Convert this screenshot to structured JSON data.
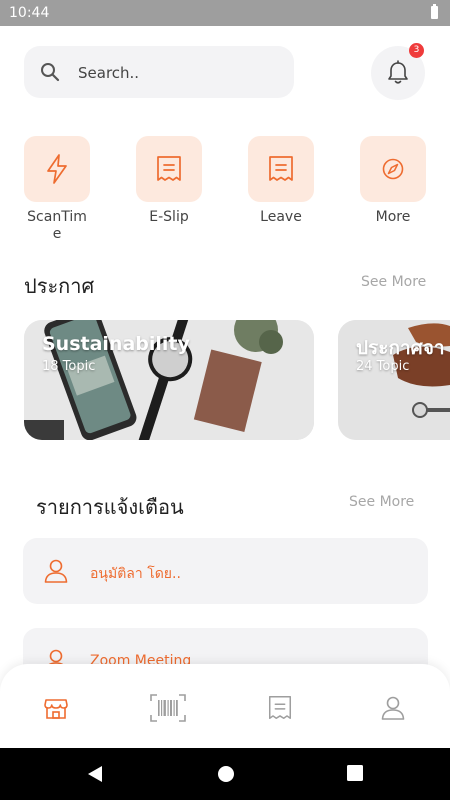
{
  "status_bar": {
    "time": "10:44"
  },
  "search": {
    "placeholder": "Search.."
  },
  "notifications_badge": "3",
  "menu": [
    {
      "label": "ScanTime",
      "icon": "lightning-icon"
    },
    {
      "label": "E-Slip",
      "icon": "receipt-icon"
    },
    {
      "label": "Leave",
      "icon": "receipt-icon"
    },
    {
      "label": "More",
      "icon": "compass-icon"
    }
  ],
  "announcements": {
    "title": "ประกาศ",
    "see_more": "See More",
    "cards": [
      {
        "title": "Sustainability",
        "subtitle": "18 Topic"
      },
      {
        "title": "ประกาศจา",
        "subtitle": "24 Topic"
      }
    ]
  },
  "alerts": {
    "title": "รายการแจ้งเตือน",
    "see_more": "See More",
    "items": [
      {
        "text": "อนุมัติลา โดย..",
        "icon": "user-icon"
      },
      {
        "text": "Zoom Meeting",
        "icon": "user-icon"
      }
    ]
  },
  "bottom_nav": [
    {
      "icon": "store-icon",
      "active": true
    },
    {
      "icon": "barcode-icon",
      "active": false
    },
    {
      "icon": "receipt-icon",
      "active": false
    },
    {
      "icon": "user-icon",
      "active": false
    }
  ],
  "colors": {
    "accent": "#ee6c30",
    "tile_bg": "#fde9de",
    "card_bg": "#f3f3f5",
    "badge": "#ef3b3b"
  }
}
